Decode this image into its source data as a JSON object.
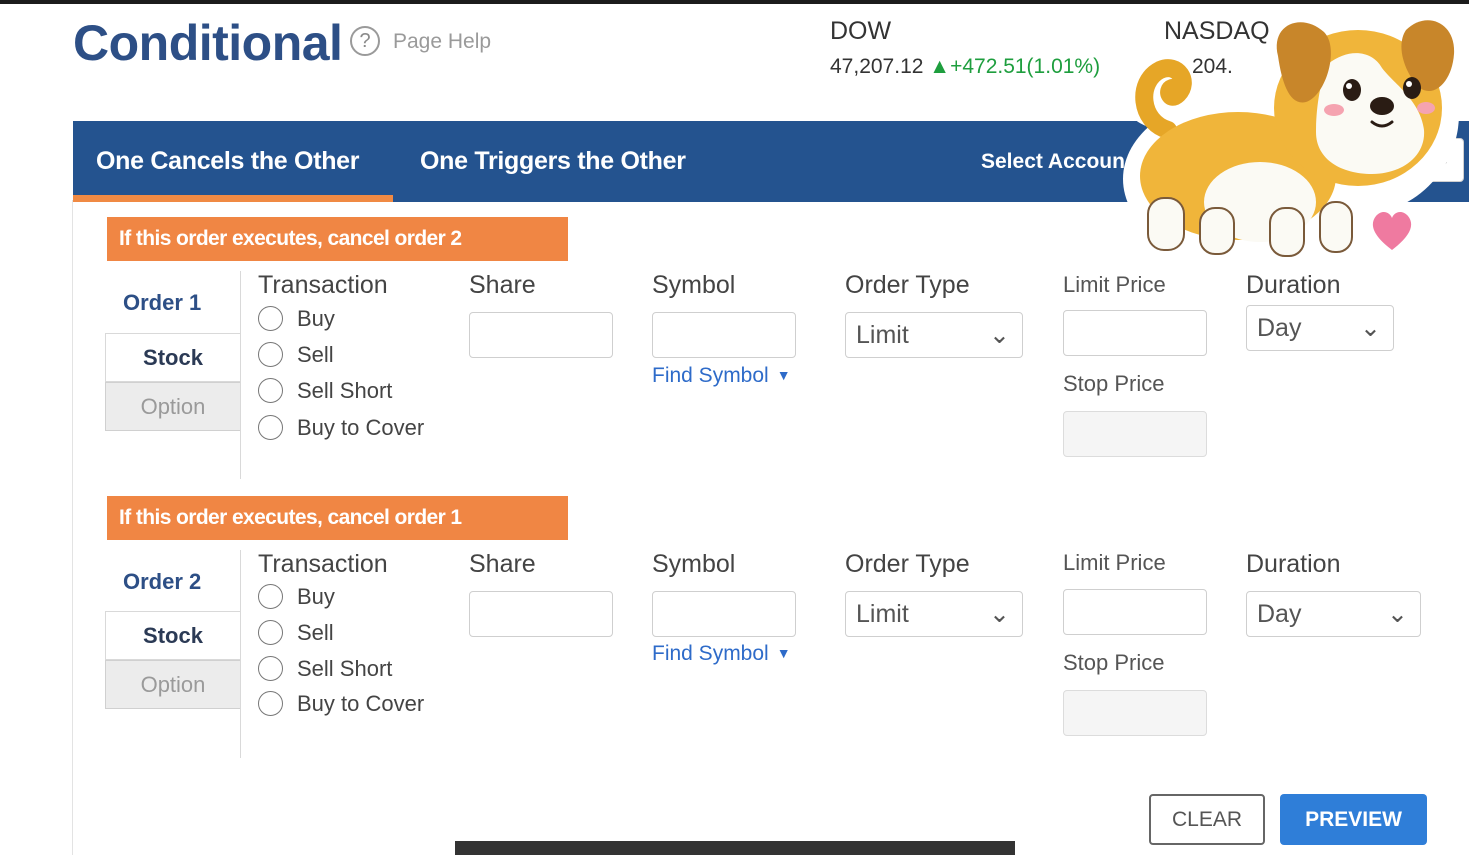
{
  "header": {
    "title": "Conditional",
    "help_label": "Page Help"
  },
  "tickers": [
    {
      "name": "DOW",
      "value": "47,207.12",
      "change": "▲+472.51(1.01%)"
    },
    {
      "name": "NASDAQ",
      "value": "204."
    }
  ],
  "tabs": {
    "items": [
      "One Cancels the Other",
      "One Triggers the Other"
    ],
    "active": 0,
    "select_account": "Select Accoun"
  },
  "orders": [
    {
      "banner": "If this order executes, cancel order 2",
      "label": "Order 1",
      "security_types": [
        "Stock",
        "Option"
      ],
      "transaction_label": "Transaction",
      "transactions": [
        "Buy",
        "Sell",
        "Sell Short",
        "Buy to Cover"
      ],
      "share_label": "Share",
      "symbol_label": "Symbol",
      "find_symbol": "Find Symbol",
      "order_type_label": "Order Type",
      "order_type_value": "Limit",
      "limit_price_label": "Limit Price",
      "stop_price_label": "Stop Price",
      "duration_label": "Duration",
      "duration_value": "Day"
    },
    {
      "banner": "If this order executes, cancel order 1",
      "label": "Order 2",
      "security_types": [
        "Stock",
        "Option"
      ],
      "transaction_label": "Transaction",
      "transactions": [
        "Buy",
        "Sell",
        "Sell Short",
        "Buy to Cover"
      ],
      "share_label": "Share",
      "symbol_label": "Symbol",
      "find_symbol": "Find Symbol",
      "order_type_label": "Order Type",
      "order_type_value": "Limit",
      "limit_price_label": "Limit Price",
      "stop_price_label": "Stop Price",
      "duration_label": "Duration",
      "duration_value": "Day"
    }
  ],
  "actions": {
    "clear": "CLEAR",
    "preview": "PREVIEW"
  },
  "colors": {
    "brand_blue": "#24538f",
    "accent_orange": "#f08644",
    "positive_green": "#1e9e3e",
    "link_blue": "#2e6bc9",
    "primary_button": "#2f7ed8"
  }
}
